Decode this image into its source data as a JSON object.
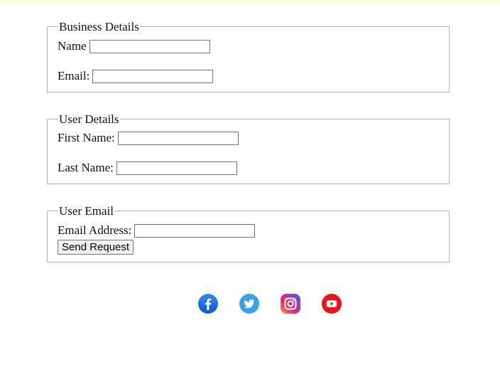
{
  "business": {
    "legend": "Business Details",
    "name_label": "Name",
    "name_value": "",
    "email_label": "Email:",
    "email_value": ""
  },
  "user": {
    "legend": "User Details",
    "first_label": "First Name:",
    "first_value": "",
    "last_label": "Last Name:",
    "last_value": ""
  },
  "contact": {
    "legend": "User Email",
    "email_label": "Email Address:",
    "email_value": "",
    "submit_label": "Send Request"
  },
  "social": {
    "icons": [
      "facebook-icon",
      "twitter-icon",
      "instagram-icon",
      "youtube-icon"
    ],
    "colors": {
      "facebook": "#1f6fd8",
      "twitter": "#3aa3e8",
      "youtube": "#e8141b",
      "banner": "#fdfbd4"
    }
  }
}
